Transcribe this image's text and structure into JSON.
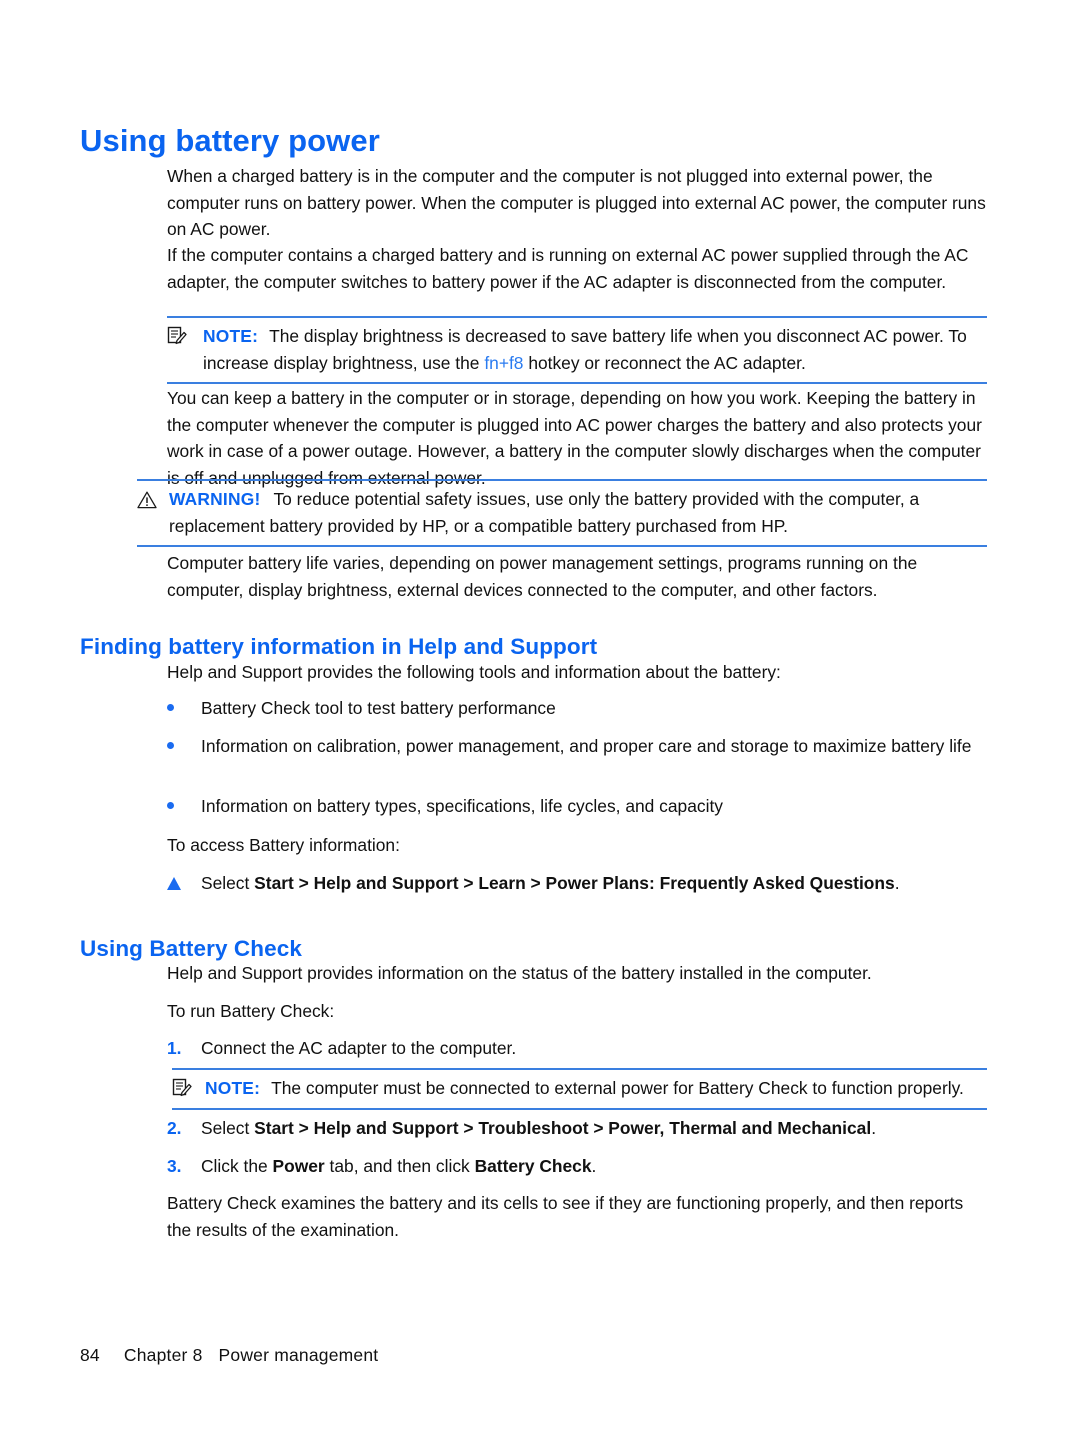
{
  "page": {
    "title": "Using battery power",
    "footer": {
      "page_number": "84",
      "chapter": "Chapter 8",
      "chapter_title": "Power management"
    },
    "colors": {
      "heading_blue": "#0a64f0",
      "rule_blue": "#3a7fe0",
      "bullet_blue": "#1a6bf0",
      "body_black": "#111111"
    }
  },
  "intro": {
    "p1": "When a charged battery is in the computer and the computer is not plugged into external power, the computer runs on battery power. When the computer is plugged into external AC power, the computer runs on AC power.",
    "p2": "If the computer contains a charged battery and is running on external AC power supplied through the AC adapter, the computer switches to battery power if the AC adapter is disconnected from the computer.",
    "p3": "You can keep a battery in the computer or in storage, depending on how you work. Keeping the battery in the computer whenever the computer is plugged into AC power charges the battery and also protects your work in case of a power outage. However, a battery in the computer slowly discharges when the computer is off and unplugged from external power.",
    "p4": "Computer battery life varies, depending on power management settings, programs running on the computer, display brightness, external devices connected to the computer, and other factors."
  },
  "note1": {
    "label": "NOTE:",
    "icon": "note-icon",
    "text_before_key": "The display brightness is decreased to save battery life when you disconnect AC power. To increase display brightness, use the ",
    "key": "fn+f8",
    "text_after_key": " hotkey or reconnect the AC adapter."
  },
  "warning": {
    "label": "WARNING!",
    "icon": "warning-triangle-icon",
    "text": "To reduce potential safety issues, use only the battery provided with the computer, a replacement battery provided by HP, or a compatible battery purchased from HP."
  },
  "section_finding": {
    "heading": "Finding battery information in Help and Support",
    "intro": "Help and Support provides the following tools and information about the battery:",
    "bullets": [
      "Battery Check tool to test battery performance",
      "Information on calibration, power management, and proper care and storage to maximize battery life",
      "Information on battery types, specifications, life cycles, and capacity"
    ],
    "access_label": "To access Battery information:",
    "step": {
      "marker": "triangle-marker",
      "prefix": "Select ",
      "bold_path": "Start > Help and Support > Learn > Power Plans: Frequently Asked Questions",
      "suffix": "."
    }
  },
  "section_battery_check": {
    "heading": "Using Battery Check",
    "intro": "Help and Support provides information on the status of the battery installed in the computer.",
    "run_label": "To run Battery Check:",
    "steps": [
      {
        "number": "1.",
        "text": "Connect the AC adapter to the computer."
      },
      {
        "number": "2.",
        "prefix": "Select ",
        "bold_path": "Start > Help and Support > Troubleshoot > Power, Thermal and Mechanical",
        "suffix": "."
      },
      {
        "number": "3.",
        "prefix": "Click the ",
        "bold1": "Power",
        "mid": " tab, and then click ",
        "bold2": "Battery Check",
        "suffix": "."
      }
    ],
    "note2": {
      "label": "NOTE:",
      "icon": "note-icon",
      "text": "The computer must be connected to external power for Battery Check to function properly."
    },
    "closing": "Battery Check examines the battery and its cells to see if they are functioning properly, and then reports the results of the examination."
  }
}
